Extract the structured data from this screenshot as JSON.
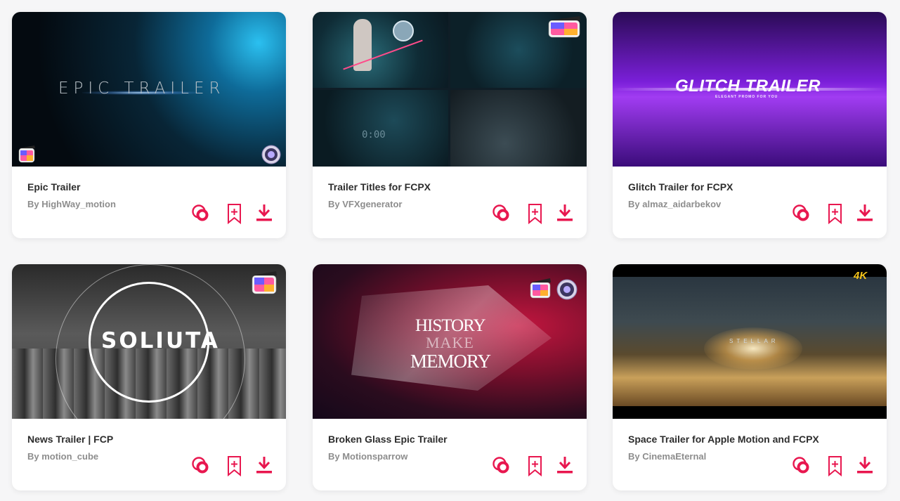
{
  "colors": {
    "accent": "#e8174f",
    "title": "#2d2d2d",
    "author": "#8d8d8d",
    "card_bg": "#ffffff",
    "page_bg": "#f6f6f7"
  },
  "icons": {
    "preview": "preview-circles-icon",
    "bookmark": "bookmark-add-icon",
    "download": "download-icon",
    "fcpx": "final-cut-pro-icon",
    "motion": "apple-motion-icon"
  },
  "cards": [
    {
      "title": "Epic Trailer",
      "author": "By HighWay_motion",
      "thumb_text": "EPIC TRAILER"
    },
    {
      "title": "Trailer Titles for FCPX",
      "author": "By VFXgenerator",
      "thumb_text": "0:00"
    },
    {
      "title": "Glitch Trailer for FCPX",
      "author": "By almaz_aidarbekov",
      "thumb_text": "GLITCH TRAILER",
      "thumb_subtext": "ELEGANT PROMO FOR YOU"
    },
    {
      "title": "News Trailer | FCP",
      "author": "By motion_cube",
      "thumb_text": "SOLIUTA"
    },
    {
      "title": "Broken Glass Epic Trailer",
      "author": "By Motionsparrow",
      "thumb_line1": "HISTORY",
      "thumb_line2": "MAKE",
      "thumb_line3": "MEMORY"
    },
    {
      "title": "Space Trailer for Apple Motion and FCPX",
      "author": "By CinemaEternal",
      "thumb_text": "STELLAR",
      "badge_4k": "4K"
    }
  ]
}
